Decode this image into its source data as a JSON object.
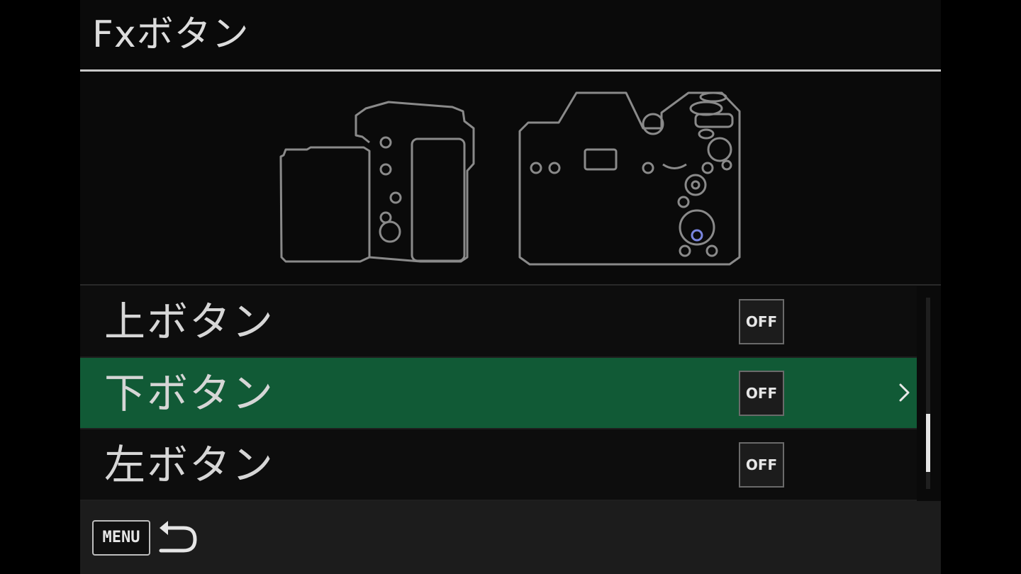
{
  "header": {
    "title": "Fxボタン"
  },
  "diagram": {
    "highlighted_button_color": "#7a86e0",
    "outline_color": "#8a8a8a"
  },
  "menu_items": [
    {
      "label": "上ボタン",
      "value": "OFF",
      "selected": false
    },
    {
      "label": "下ボタン",
      "value": "OFF",
      "selected": true
    },
    {
      "label": "左ボタン",
      "value": "OFF",
      "selected": false
    }
  ],
  "colors": {
    "selected_row": "#115a36",
    "background": "#0a0a0a"
  },
  "footer": {
    "menu_label": "MENU",
    "back_icon": "return-arrow-icon"
  }
}
